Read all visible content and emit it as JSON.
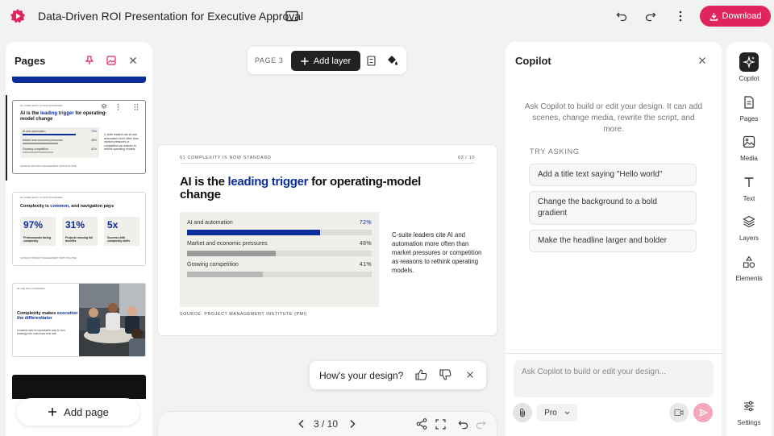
{
  "topbar": {
    "title": "Data-Driven ROI Presentation for Executive Approval",
    "download_label": "Download",
    "accent": "#e0245e"
  },
  "pages_panel": {
    "title": "Pages",
    "add_page_label": "Add page",
    "thumbnails": [
      {
        "section": "01  COMPLEXITY IS NOW STANDARD",
        "headline_before": "AI is the ",
        "headline_highlight": "leading trigger",
        "headline_after": " for operating-model change",
        "rows": [
          {
            "label": "AI and automation",
            "value": "72%"
          },
          {
            "label": "Market and economic pressures",
            "value": "48%"
          },
          {
            "label": "Growing competition",
            "value": "41%"
          }
        ],
        "body": "C-suite leaders cite AI and automation more often than market pressures or competition as reasons to rethink operating models.",
        "source": "SOURCE: PROJECT MANAGEMENT INSTITUTE (PMI)"
      },
      {
        "section": "02  COMPLEXITY IS NOW STANDARD",
        "headline_before": "Complexity is ",
        "headline_highlight": "common",
        "headline_after": ", and navigation pays",
        "stats": [
          {
            "value": "97%",
            "label": "Professionals facing complexity"
          },
          {
            "value": "31%",
            "label": "Projects missing full benefits"
          },
          {
            "value": "5x",
            "label": "Success with complexity skills"
          }
        ],
        "source": "SOURCE: PROJECT MANAGEMENT INSTITUTE (PMI)"
      },
      {
        "section": "03  THE PATH FORWARD",
        "headline_before": "Complexity makes ",
        "headline_highlight": "execution the differentiator",
        "headline_after": "",
        "body": "Leaders need a repeatable way to turn strategy into outcomes that last."
      }
    ]
  },
  "canvas_toolbar": {
    "page_label": "PAGE 3",
    "add_layer_label": "Add layer"
  },
  "slide": {
    "section": "01  COMPLEXITY IS NOW STANDARD",
    "page_num": "03 / 10",
    "headline_before": "AI is the ",
    "headline_highlight": "leading trigger",
    "headline_after": " for operating-model change",
    "body": "C-suite leaders cite AI and automation more often than market pressures or competition as reasons to rethink operating models.",
    "source": "SOURCE: PROJECT MANAGEMENT INSTITUTE (PMI)",
    "bars": [
      {
        "label": "AI and automation",
        "value_text": "72%",
        "value": 72,
        "color": "#0b2e9c"
      },
      {
        "label": "Market and economic pressures",
        "value_text": "48%",
        "value": 48,
        "color": "#9b9b9b"
      },
      {
        "label": "Growing competition",
        "value_text": "41%",
        "value": 41,
        "color": "#b8b8b8"
      }
    ],
    "highlight_color": "#0b2e9c"
  },
  "feedback": {
    "question": "How's your design?"
  },
  "bottombar": {
    "page_indicator": "3 / 10"
  },
  "copilot": {
    "title": "Copilot",
    "help_text": "Ask Copilot to build or edit your design. It can add scenes, change media, rewrite the script, and more.",
    "try_asking": "TRY ASKING",
    "suggestions": [
      "Add a title text saying \"Hello world\"",
      "Change the background to a bold gradient",
      "Make the headline larger and bolder"
    ],
    "input_placeholder": "Ask Copilot to build or edit your design...",
    "model": "Pro"
  },
  "rail": {
    "items": [
      {
        "label": "Copilot",
        "icon": "sparkle-icon"
      },
      {
        "label": "Pages",
        "icon": "page-icon"
      },
      {
        "label": "Media",
        "icon": "image-icon"
      },
      {
        "label": "Text",
        "icon": "text-icon"
      },
      {
        "label": "Layers",
        "icon": "layers-icon"
      },
      {
        "label": "Elements",
        "icon": "shapes-icon"
      }
    ],
    "settings_label": "Settings"
  }
}
